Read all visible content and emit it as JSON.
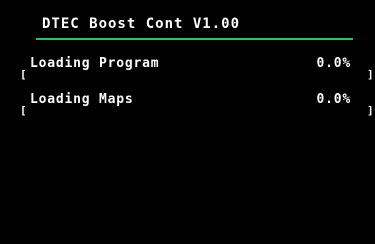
{
  "header": {
    "title": "DTEC Boost Cont V1.00"
  },
  "colors": {
    "background": "#000000",
    "text": "#ffffff",
    "accent": "#22c55e"
  },
  "status": {
    "items": [
      {
        "label": "Loading Program",
        "value": "0.0%",
        "bracket_left": "[",
        "bracket_right": "]"
      },
      {
        "label": "Loading Maps",
        "value": "0.0%",
        "bracket_left": "[",
        "bracket_right": "]"
      }
    ]
  }
}
